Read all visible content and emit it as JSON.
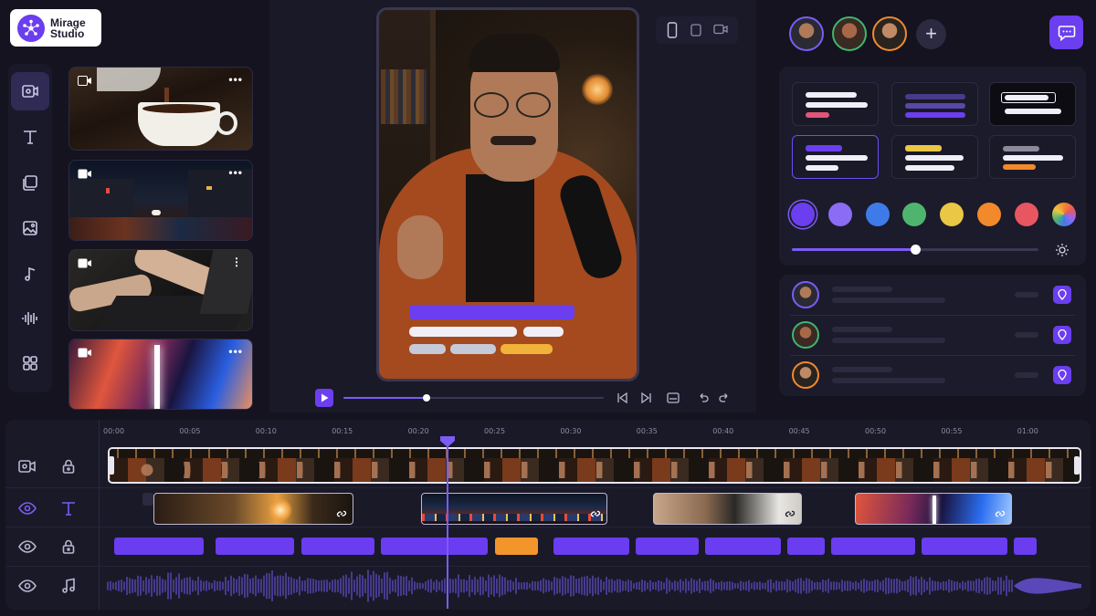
{
  "app": {
    "name": "Mirage Studio",
    "logo_line1": "Mirage",
    "logo_line2": "Studio"
  },
  "sidebar": {
    "tools": [
      {
        "icon": "camera-icon",
        "active": true
      },
      {
        "icon": "text-icon"
      },
      {
        "icon": "layers-icon"
      },
      {
        "icon": "image-icon"
      },
      {
        "icon": "music-icon"
      },
      {
        "icon": "waveform-icon"
      },
      {
        "icon": "apps-grid-icon"
      }
    ]
  },
  "media_bin": {
    "clips": [
      {
        "name": "coffee",
        "menu": "•••"
      },
      {
        "name": "city-night",
        "menu": "•••"
      },
      {
        "name": "typing-laptop",
        "menu": "⋮"
      },
      {
        "name": "gradient-light",
        "menu": "•••"
      }
    ]
  },
  "player": {
    "progress_fraction": 0.32
  },
  "timeline": {
    "ticks": [
      "00:00",
      "00:05",
      "00:10",
      "00:15",
      "00:20",
      "00:25",
      "00:30",
      "00:35",
      "00:40",
      "00:45",
      "00:50",
      "00:55",
      "01:00"
    ],
    "playhead_time": "00:22"
  },
  "colors": {
    "accent": "#6b3ef0",
    "swatches": [
      "#6b3ef0",
      "#8b6cf5",
      "#3f7be8",
      "#4fb56e",
      "#eac745",
      "#f2892b",
      "#e85661",
      "gradient"
    ],
    "selected_swatch": 0
  },
  "slider": {
    "value_fraction": 0.5
  },
  "collaborators": {
    "count": 3,
    "add_label": "+"
  }
}
